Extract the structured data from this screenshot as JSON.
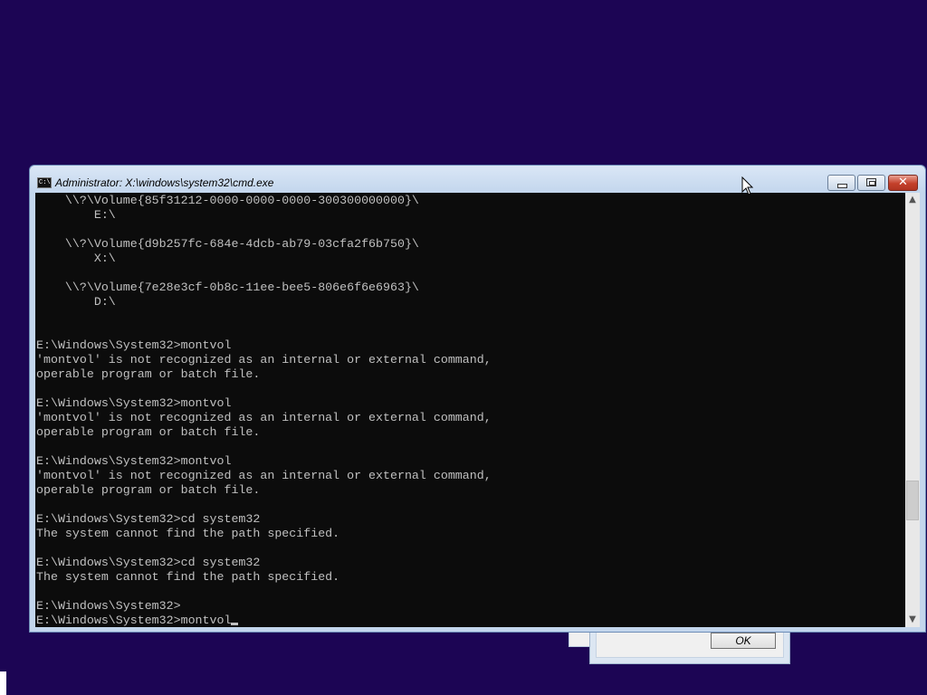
{
  "desktop": {
    "background_color": "#1c0554"
  },
  "background_dialog": {
    "ok_label": "OK"
  },
  "window": {
    "title": "Administrator: X:\\windows\\system32\\cmd.exe",
    "icon_text": "C:\\",
    "buttons": {
      "minimize": "minimize",
      "maximize": "maximize",
      "close": "✕"
    }
  },
  "console": {
    "output": "    \\\\?\\Volume{85f31212-0000-0000-0000-300300000000}\\\n        E:\\\n\n    \\\\?\\Volume{d9b257fc-684e-4dcb-ab79-03cfa2f6b750}\\\n        X:\\\n\n    \\\\?\\Volume{7e28e3cf-0b8c-11ee-bee5-806e6f6e6963}\\\n        D:\\\n\n\nE:\\Windows\\System32>montvol\n'montvol' is not recognized as an internal or external command,\noperable program or batch file.\n\nE:\\Windows\\System32>montvol\n'montvol' is not recognized as an internal or external command,\noperable program or batch file.\n\nE:\\Windows\\System32>montvol\n'montvol' is not recognized as an internal or external command,\noperable program or batch file.\n\nE:\\Windows\\System32>cd system32\nThe system cannot find the path specified.\n\nE:\\Windows\\System32>cd system32\nThe system cannot find the path specified.\n\nE:\\Windows\\System32>",
    "current_prompt": "E:\\Windows\\System32>montvol",
    "text_color": "#c0c0c0",
    "background_color": "#0c0c0c"
  },
  "scrollbar": {
    "up_arrow": "▲",
    "down_arrow": "▼"
  }
}
